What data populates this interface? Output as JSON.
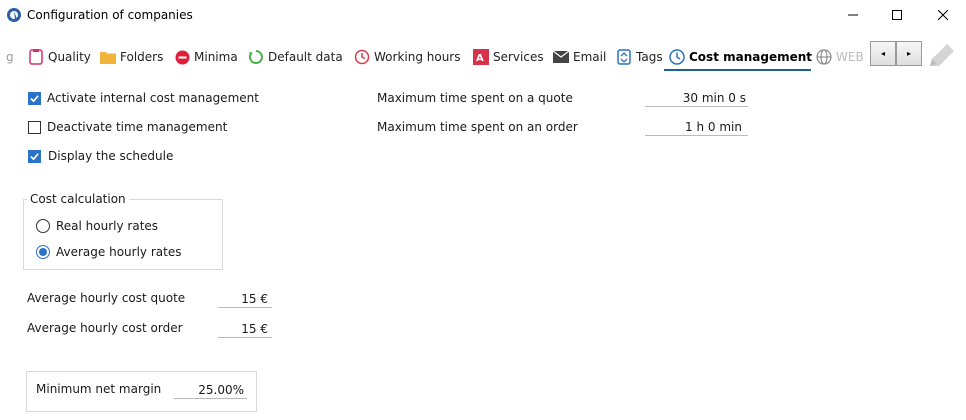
{
  "window": {
    "title": "Configuration of companies",
    "minimize_glyph": "—",
    "maximize_glyph": "☐",
    "close_glyph": "✕"
  },
  "tabs": [
    {
      "label": "g",
      "icon": "clipped-tab-icon"
    },
    {
      "label": "Quality",
      "icon": "quality-icon",
      "color": "#d6336c"
    },
    {
      "label": "Folders",
      "icon": "folder-icon",
      "color": "#f3b43c"
    },
    {
      "label": "Minima",
      "icon": "minima-icon",
      "color": "#e0203a"
    },
    {
      "label": "Default data",
      "icon": "default-data-icon",
      "color": "#3bab3b"
    },
    {
      "label": "Working hours",
      "icon": "working-hours-icon",
      "color": "#d63a4a"
    },
    {
      "label": "Services",
      "icon": "services-icon",
      "color": "#d6334a"
    },
    {
      "label": "Email",
      "icon": "email-icon",
      "color": "#444444"
    },
    {
      "label": "Tags",
      "icon": "tags-icon",
      "color": "#2b73c8"
    },
    {
      "label": "Cost management",
      "icon": "clock-icon",
      "color": "#2b73c8",
      "active": true
    },
    {
      "label": "WEB",
      "icon": "globe-icon",
      "color": "#888888"
    }
  ],
  "tab_scroll": {
    "left": "◂",
    "right": "▸"
  },
  "settings": {
    "activate_cost_mgmt": {
      "label": "Activate internal cost management",
      "checked": true
    },
    "deactivate_time_mgmt": {
      "label": "Deactivate time management",
      "checked": false
    },
    "display_schedule": {
      "label": "Display the schedule",
      "checked": true
    },
    "max_time_quote": {
      "label": "Maximum time spent on a quote",
      "value": "30 min 0 s"
    },
    "max_time_order": {
      "label": "Maximum time spent on an order",
      "value": "1 h 0 min"
    }
  },
  "cost_calculation": {
    "legend": "Cost calculation",
    "options": [
      {
        "label": "Real hourly rates",
        "selected": false
      },
      {
        "label": "Average hourly rates",
        "selected": true
      }
    ]
  },
  "average_costs": {
    "quote": {
      "label": "Average hourly cost quote",
      "value": "15 €"
    },
    "order": {
      "label": "Average hourly cost order",
      "value": "15 €"
    }
  },
  "margin": {
    "label": "Minimum net margin",
    "value": "25.00%"
  },
  "colors": {
    "accent": "#2b73c8",
    "active_tab_underline": "#1f5f99"
  }
}
